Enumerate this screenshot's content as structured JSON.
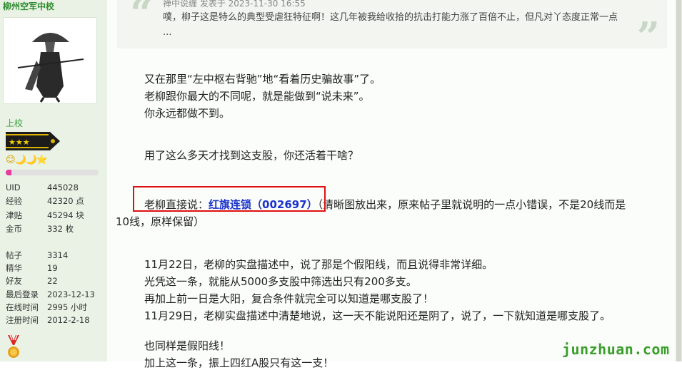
{
  "user": {
    "name": "柳州空军中校",
    "rank": "上校",
    "emoticons": "😊🌙🌙⭐",
    "progress": 0.06,
    "stats": [
      {
        "k": "UID",
        "v": "445028"
      },
      {
        "k": "经验",
        "v": "42320 点"
      },
      {
        "k": "津贴",
        "v": "45294 块"
      },
      {
        "k": "金币",
        "v": "332 枚"
      }
    ],
    "stats2": [
      {
        "k": "帖子",
        "v": "3314"
      },
      {
        "k": "精华",
        "v": "19"
      },
      {
        "k": "好友",
        "v": "22"
      },
      {
        "k": "最后登录",
        "v": "2023-12-13"
      },
      {
        "k": "在线时间",
        "v": "2995 小时"
      },
      {
        "k": "注册时间",
        "v": "2012-2-18"
      }
    ]
  },
  "quote": {
    "meta": "禅中说缠 发表于 2023-11-30 16:55",
    "text": "噗，柳子这是特么的典型受虐狂特征啊！这几年被我给收拾的抗击打能力涨了百倍不止，但凡对丫态度正常一点 ..."
  },
  "post": {
    "l1": "又在那里“左中枢右背驰”地“看着历史骗故事”了。",
    "l2": "老柳跟你最大的不同呢，就是能做到“说未来”。",
    "l3": "你永远都做不到。",
    "l4": "用了这么多天才找到这支股，你还活着干啥？",
    "l5a": "老柳直接说：",
    "l5link": "红旗连锁（002697）",
    "l5b": "（清晰图放出来，原来帖子里就说明的一点小错误，不是20线而是",
    "l6": "10线，原样保留）",
    "l7": "11月22日，老柳的实盘描述中，说了那是个假阳线，而且说得非常详细。",
    "l8": "光凭这一条，就能从5000多支股中筛选出只有200多支。",
    "l9": "再加上前一日是大阳，复合条件就完全可以知道是哪支股了！",
    "l10": "11月29日，老柳实盘描述中清楚地说，这一天不能说阳还是阴了，说了，一下就知道是哪支股了。",
    "l11": "也同样是假阳线！",
    "l12": "加上这一条，振上四红A股只有这一支！"
  },
  "watermark": "junzhuan.com"
}
